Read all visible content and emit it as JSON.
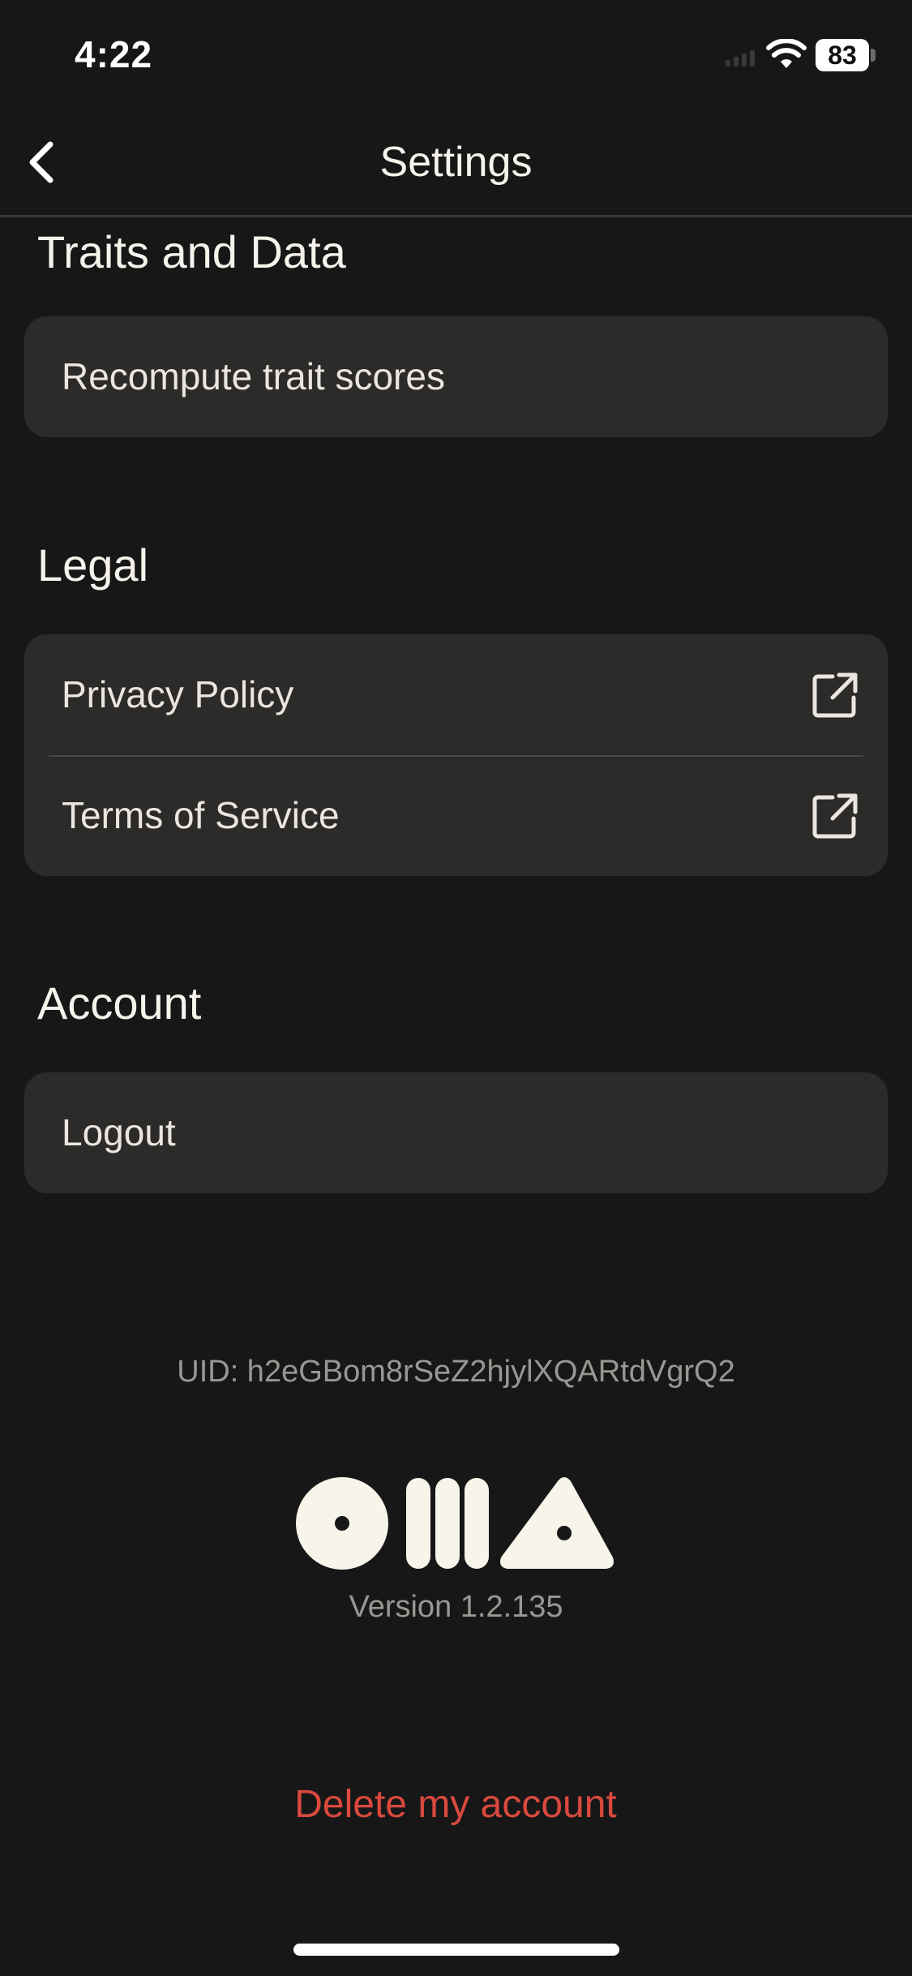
{
  "status_bar": {
    "time": "4:22",
    "battery": "83"
  },
  "nav": {
    "title": "Settings",
    "back_icon": "chevron-left-icon"
  },
  "sections": {
    "traits": {
      "title": "Traits and Data",
      "items": [
        {
          "label": "Recompute trait scores"
        }
      ]
    },
    "legal": {
      "title": "Legal",
      "items": [
        {
          "label": "Privacy Policy",
          "icon": "external-link-icon"
        },
        {
          "label": "Terms of Service",
          "icon": "external-link-icon"
        }
      ]
    },
    "account": {
      "title": "Account",
      "items": [
        {
          "label": "Logout"
        }
      ]
    }
  },
  "footer": {
    "uid": "UID: h2eGBom8rSeZ2hjylXQARtdVgrQ2",
    "logo_icon": "oma-logo-icon",
    "version": "Version 1.2.135",
    "delete_label": "Delete my account"
  },
  "colors": {
    "background": "#181717",
    "card": "#2d2a2a",
    "text": "#f6f3ec",
    "muted": "#9a9793",
    "danger": "#d9493e"
  }
}
